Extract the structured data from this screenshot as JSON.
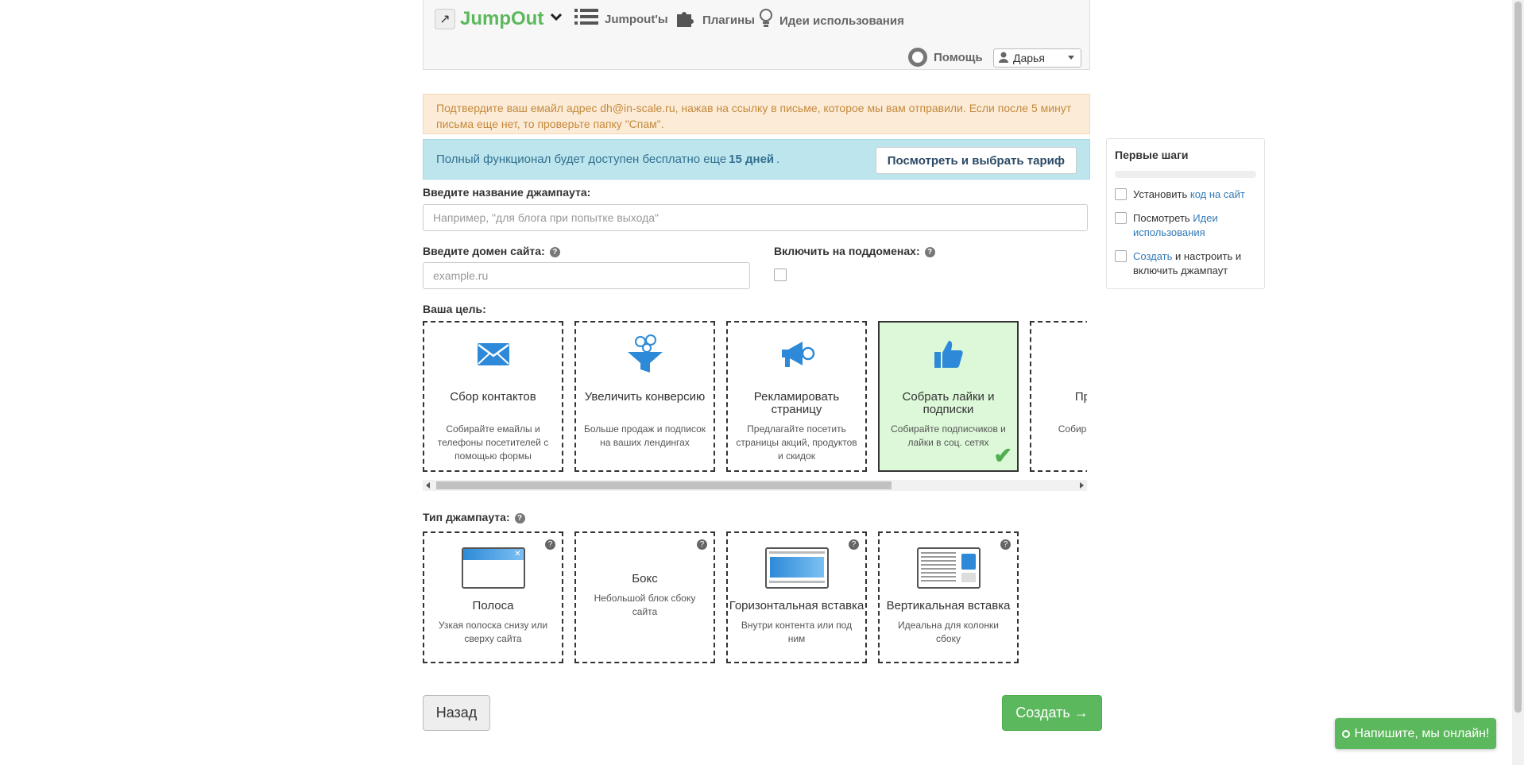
{
  "header": {
    "logo_text": "JumpOut",
    "nav": [
      {
        "label": "Jumpout'ы",
        "icon": "list-icon"
      },
      {
        "label": "Плагины",
        "icon": "puzzle-icon"
      },
      {
        "label": "Идеи использования",
        "icon": "lightbulb-icon"
      }
    ],
    "help_label": "Помощь",
    "user_name": "Дарья"
  },
  "alerts": {
    "warning": "Подтвердите ваш емайл адрес dh@in-scale.ru, нажав на ссылку в письме, которое мы вам отправили. Если после 5 минут письма еще нет, то проверьте папку \"Спам\".",
    "info_prefix": "Полный функционал будет доступен бесплатно еще",
    "info_bold": "15 дней",
    "info_suffix": ".",
    "tariff_button": "Посмотреть и выбрать тариф"
  },
  "form": {
    "name_label": "Введите название джампаута:",
    "name_placeholder": "Например, \"для блога при попытке выхода\"",
    "domain_label": "Введите домен сайта:",
    "domain_placeholder": "example.ru",
    "subdomain_label": "Включить на поддоменах:",
    "goal_label": "Ваша цель:",
    "type_label": "Тип джампаута:"
  },
  "goals": [
    {
      "title": "Сбор контактов",
      "desc": "Собирайте емайлы и телефоны посетителей с помощью формы",
      "icon": "envelope-icon"
    },
    {
      "title": "Увеличить конверсию",
      "desc": "Больше продаж и подписок на ваших лендингах",
      "icon": "funnel-icon"
    },
    {
      "title": "Рекламировать страницу",
      "desc": "Предлагайте посетить страницы акций, продуктов и скидок",
      "icon": "megaphone-icon"
    },
    {
      "title": "Собрать лайки и подписки",
      "desc": "Собирайте подписчиков и лайки в соц. сетях",
      "icon": "thumbs-up-icon"
    },
    {
      "title": "Пред поз",
      "desc": "Собира предлага з",
      "icon": "partial-icon"
    }
  ],
  "types": [
    {
      "title": "Полоса",
      "desc": "Узкая полоска снизу или сверху сайта"
    },
    {
      "title": "Бокс",
      "desc": "Небольшой блок сбоку сайта"
    },
    {
      "title": "Горизонтальная вставка",
      "desc": "Внутри контента или под ним"
    },
    {
      "title": "Вертикальная вставка",
      "desc": "Идеальна для колонки сбоку"
    }
  ],
  "buttons": {
    "back": "Назад",
    "create": "Создать →"
  },
  "side": {
    "title": "Первые шаги",
    "step1_text": "Установить",
    "step1_link": "код на сайт",
    "step2_text": "Посмотреть",
    "step2_link": "Идеи использования",
    "step3_link": "Создать",
    "step3_text": "и настроить и включить джампаут"
  },
  "chat": {
    "label": "Напишите, мы онлайн!"
  },
  "colors": {
    "brand_green": "#5cb85c",
    "warning_bg": "#fcebd7",
    "info_bg": "#bde5ee",
    "selected_card_bg": "#dcf8d8",
    "icon_blue": "#2e8ad8"
  }
}
